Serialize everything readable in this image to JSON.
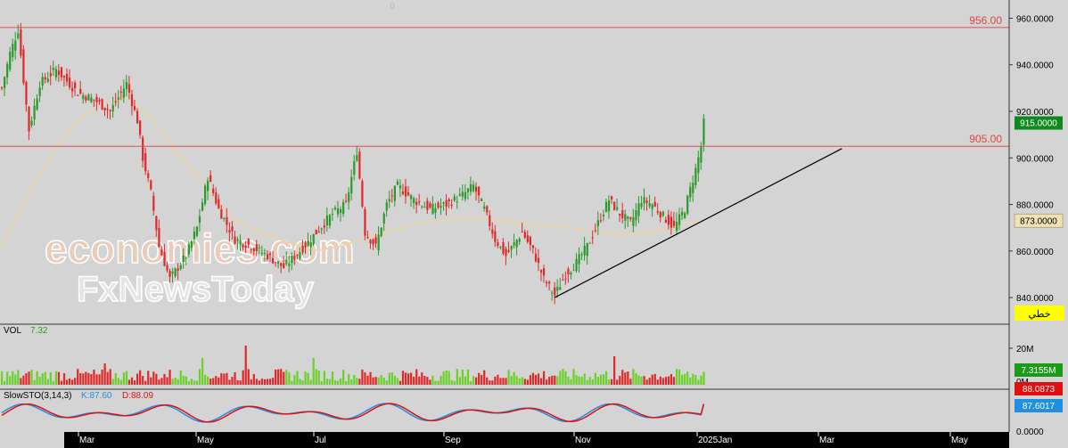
{
  "zero_marker": "0",
  "watermark": {
    "line1": "economies.com",
    "line2": "FxNewsToday"
  },
  "main": {
    "y_ticks": [
      "960.0000",
      "940.0000",
      "920.0000",
      "900.0000",
      "880.0000",
      "860.0000",
      "840.0000"
    ],
    "h_lines": [
      {
        "value": 956.0,
        "label": "956.00"
      },
      {
        "value": 905.0,
        "label": "905.00"
      }
    ],
    "price_tag": {
      "label": "915.0000",
      "value": 915,
      "color": "#0d8a1e"
    },
    "ma_tag": {
      "label": "873.0000",
      "value": 873,
      "color": "#f0e2b6"
    },
    "arabic_tag": {
      "label": "خطي",
      "color": "#ffff00"
    }
  },
  "volume": {
    "title": "VOL",
    "value": "7.32",
    "y_ticks": [
      "20M",
      "10M",
      "0M"
    ],
    "tags": [
      {
        "label": "7.3155M",
        "color": "#1a9b1a"
      }
    ]
  },
  "stoch": {
    "title": "SlowSTO(3,14,3)",
    "k": "K:87.60",
    "d": "D:88.09",
    "y_ticks": [
      "0.0000"
    ],
    "tags": [
      {
        "label": "88.0873",
        "color": "#e01010"
      },
      {
        "label": "87.6017",
        "color": "#1f8fe0"
      }
    ]
  },
  "x_axis": [
    "Mar",
    "May",
    "Jul",
    "Sep",
    "Nov",
    "2025Jan",
    "Mar",
    "May"
  ],
  "chart_data": [
    {
      "type": "candlestick",
      "ylim": [
        832,
        964
      ],
      "y_ticks": [
        960,
        940,
        920,
        900,
        880,
        860,
        840
      ],
      "horizontal_lines": [
        956,
        905
      ],
      "last_price": 915,
      "moving_average_last": 873,
      "anchors": [
        {
          "i": 0,
          "c": 930
        },
        {
          "i": 3,
          "c": 945
        },
        {
          "i": 6,
          "c": 955
        },
        {
          "i": 10,
          "c": 912
        },
        {
          "i": 14,
          "c": 932
        },
        {
          "i": 20,
          "c": 938
        },
        {
          "i": 28,
          "c": 928
        },
        {
          "i": 34,
          "c": 925
        },
        {
          "i": 40,
          "c": 920
        },
        {
          "i": 46,
          "c": 932
        },
        {
          "i": 50,
          "c": 916
        },
        {
          "i": 52,
          "c": 900
        },
        {
          "i": 55,
          "c": 885
        },
        {
          "i": 58,
          "c": 862
        },
        {
          "i": 62,
          "c": 848
        },
        {
          "i": 68,
          "c": 858
        },
        {
          "i": 72,
          "c": 870
        },
        {
          "i": 76,
          "c": 892
        },
        {
          "i": 80,
          "c": 878
        },
        {
          "i": 86,
          "c": 865
        },
        {
          "i": 92,
          "c": 862
        },
        {
          "i": 98,
          "c": 858
        },
        {
          "i": 104,
          "c": 853
        },
        {
          "i": 110,
          "c": 860
        },
        {
          "i": 116,
          "c": 868
        },
        {
          "i": 122,
          "c": 876
        },
        {
          "i": 127,
          "c": 880
        },
        {
          "i": 131,
          "c": 903
        },
        {
          "i": 134,
          "c": 868
        },
        {
          "i": 138,
          "c": 862
        },
        {
          "i": 142,
          "c": 880
        },
        {
          "i": 146,
          "c": 888
        },
        {
          "i": 152,
          "c": 882
        },
        {
          "i": 158,
          "c": 878
        },
        {
          "i": 164,
          "c": 880
        },
        {
          "i": 170,
          "c": 884
        },
        {
          "i": 174,
          "c": 888
        },
        {
          "i": 178,
          "c": 878
        },
        {
          "i": 182,
          "c": 865
        },
        {
          "i": 186,
          "c": 858
        },
        {
          "i": 192,
          "c": 868
        },
        {
          "i": 196,
          "c": 860
        },
        {
          "i": 200,
          "c": 848
        },
        {
          "i": 204,
          "c": 841
        },
        {
          "i": 208,
          "c": 850
        },
        {
          "i": 212,
          "c": 855
        },
        {
          "i": 216,
          "c": 862
        },
        {
          "i": 220,
          "c": 872
        },
        {
          "i": 224,
          "c": 882
        },
        {
          "i": 228,
          "c": 876
        },
        {
          "i": 232,
          "c": 872
        },
        {
          "i": 236,
          "c": 882
        },
        {
          "i": 240,
          "c": 880
        },
        {
          "i": 244,
          "c": 875
        },
        {
          "i": 248,
          "c": 870
        },
        {
          "i": 252,
          "c": 878
        },
        {
          "i": 256,
          "c": 895
        },
        {
          "i": 258,
          "c": 905
        },
        {
          "i": 259,
          "c": 915
        }
      ],
      "moving_average": [
        {
          "i": 0,
          "v": 862
        },
        {
          "i": 10,
          "v": 885
        },
        {
          "i": 20,
          "v": 905
        },
        {
          "i": 30,
          "v": 918
        },
        {
          "i": 40,
          "v": 924
        },
        {
          "i": 46,
          "v": 926
        },
        {
          "i": 55,
          "v": 917
        },
        {
          "i": 65,
          "v": 902
        },
        {
          "i": 75,
          "v": 888
        },
        {
          "i": 85,
          "v": 874
        },
        {
          "i": 95,
          "v": 868
        },
        {
          "i": 105,
          "v": 864
        },
        {
          "i": 115,
          "v": 860
        },
        {
          "i": 125,
          "v": 862
        },
        {
          "i": 135,
          "v": 866
        },
        {
          "i": 145,
          "v": 869
        },
        {
          "i": 155,
          "v": 872
        },
        {
          "i": 170,
          "v": 874
        },
        {
          "i": 180,
          "v": 874
        },
        {
          "i": 190,
          "v": 872
        },
        {
          "i": 200,
          "v": 871
        },
        {
          "i": 210,
          "v": 870
        },
        {
          "i": 220,
          "v": 868
        },
        {
          "i": 230,
          "v": 867
        },
        {
          "i": 240,
          "v": 868
        },
        {
          "i": 250,
          "v": 871
        },
        {
          "i": 259,
          "v": 873
        }
      ],
      "trendline": {
        "from": {
          "i": 204,
          "v": 840
        },
        "to": {
          "i": 310,
          "v": 904
        }
      }
    },
    {
      "type": "bar",
      "title": "VOL",
      "ylim": [
        0,
        26
      ],
      "y_ticks": [
        20,
        10,
        0
      ],
      "last_value": 7.32,
      "spikes": [
        {
          "i": 90,
          "v": 22
        },
        {
          "i": 38,
          "v": 12
        },
        {
          "i": 226,
          "v": 16
        },
        {
          "i": 74,
          "v": 15
        },
        {
          "i": 115,
          "v": 15
        }
      ]
    },
    {
      "type": "line",
      "title": "SlowSTO(3,14,3)",
      "ylim": [
        0,
        100
      ],
      "series": [
        {
          "name": "K",
          "color": "#1f8fe0",
          "last": 87.6
        },
        {
          "name": "D",
          "color": "#e01010",
          "last": 88.09
        }
      ]
    }
  ]
}
